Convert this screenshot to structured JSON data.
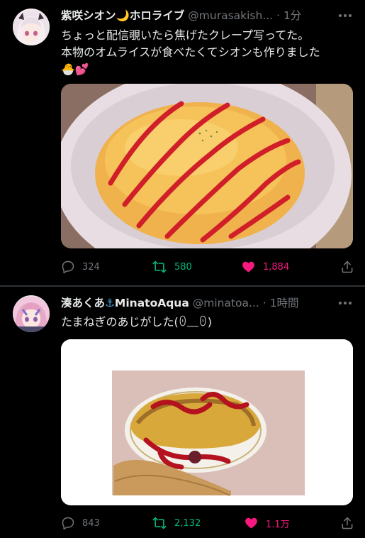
{
  "tweets": [
    {
      "name": "紫咲シオン",
      "name_emoji": "🌙",
      "name_suffix": "ホロライブ",
      "handle": "@murasakish...",
      "dot": "·",
      "time": "1分",
      "text_line1": "ちょっと配信覗いたら焦げたクレープ写ってた。",
      "text_line2": "本物のオムライスが食べたくてシオンも作りました",
      "text_emoji": "🐣💕",
      "replies": "324",
      "retweets": "580",
      "likes": "1,884",
      "liked": true,
      "retweeted": false
    },
    {
      "name": "湊あくあ",
      "name_emoji": "⚓",
      "name_suffix": "MinatoAqua",
      "handle": "@minatoa...",
      "dot": "·",
      "time": "1時間",
      "text": "たまねぎのあじがした(ꏿ﹏ꏿ)",
      "replies": "843",
      "retweets": "2,132",
      "likes": "1.1万",
      "liked": true,
      "retweeted": true
    }
  ],
  "icons": [
    "more-icon",
    "reply-icon",
    "retweet-icon",
    "like-icon",
    "share-icon"
  ],
  "colors": {
    "background": "#000000",
    "text": "#e7e9ea",
    "muted": "#71767b",
    "retweet_active": "#00ba7c",
    "like_active": "#f91880"
  }
}
